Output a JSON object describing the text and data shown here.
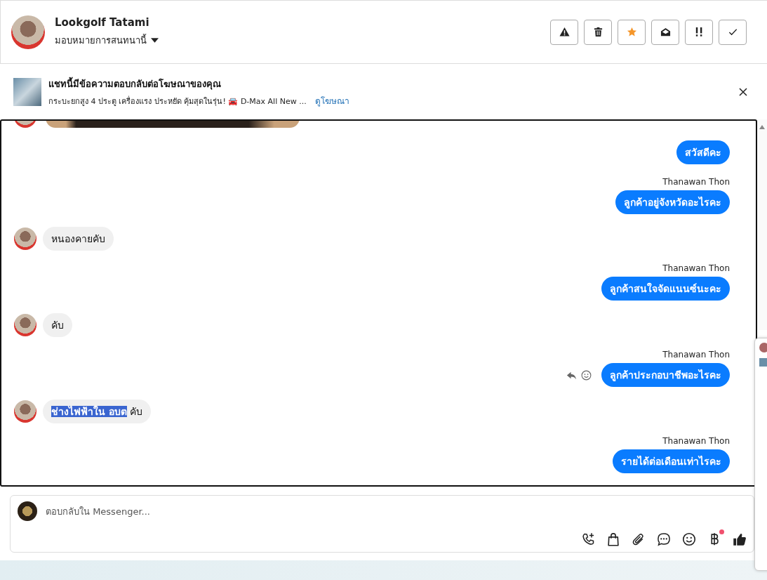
{
  "header": {
    "name": "Lookgolf Tatami",
    "assign_label": "มอบหมายการสนทนานี้",
    "actions": [
      {
        "kind": "warning",
        "active": false
      },
      {
        "kind": "trash",
        "active": false
      },
      {
        "kind": "star",
        "active": true
      },
      {
        "kind": "envelope",
        "active": false
      },
      {
        "kind": "priority",
        "active": false
      },
      {
        "kind": "check",
        "active": false
      }
    ]
  },
  "ad_banner": {
    "title": "แชทนี้มีข้อความตอบกลับต่อโฆษณาของคุณ",
    "description": "กระบะยกสูง 4 ประตู เครื่องแรง ประหยัด คุ้มสุดในรุ่น! 🚘 D-Max All New ...",
    "link": "ดูโฆษณา"
  },
  "messages": [
    {
      "kind": "image"
    },
    {
      "kind": "out",
      "text": "สวัสดีคะ",
      "actions": false
    },
    {
      "kind": "out",
      "sender": "Thanawan Thon",
      "text": "ลูกค้าอยู่จังหวัดอะไรคะ",
      "actions": false
    },
    {
      "kind": "in",
      "text": "หนองคายคับ"
    },
    {
      "kind": "out",
      "sender": "Thanawan Thon",
      "text": "ลูกค้าสนใจจัดแนนซ์นะคะ",
      "actions": false
    },
    {
      "kind": "in",
      "text": "คับ"
    },
    {
      "kind": "out",
      "sender": "Thanawan Thon",
      "text": "ลูกค้าประกอบาชีพอะไรคะ",
      "actions": true
    },
    {
      "kind": "in",
      "highlighted": "ช่างไฟฟ้าใน อบต",
      "text": "คับ"
    },
    {
      "kind": "out",
      "sender": "Thanawan Thon",
      "text": "รายได้ต่อเดือนเท่าไรคะ",
      "actions": false
    }
  ],
  "composer": {
    "placeholder": "ตอบกลับใน Messenger...",
    "tools": [
      {
        "kind": "call",
        "badge": false
      },
      {
        "kind": "bag",
        "badge": false
      },
      {
        "kind": "clip",
        "badge": false
      },
      {
        "kind": "chat",
        "badge": false
      },
      {
        "kind": "smile",
        "badge": false
      },
      {
        "kind": "baht",
        "badge": true
      },
      {
        "kind": "like",
        "badge": false
      }
    ]
  }
}
